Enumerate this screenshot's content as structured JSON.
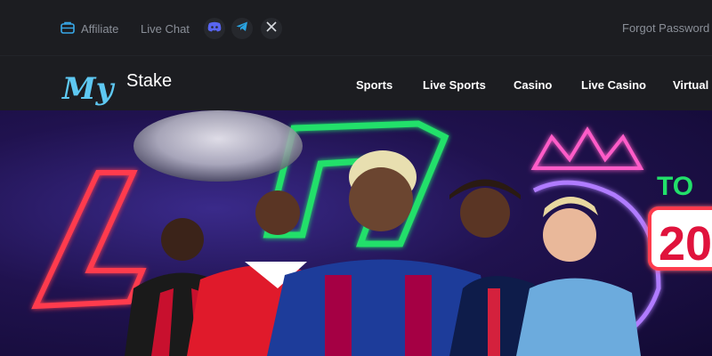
{
  "topbar": {
    "affiliate_label": "Affiliate",
    "live_chat_label": "Live Chat",
    "social": [
      "discord-icon",
      "telegram-icon",
      "x-icon"
    ],
    "forgot_password_label": "Forgot Password"
  },
  "brand": {
    "logo_script": "My",
    "logo_word": "Stake",
    "logo_color": "#5ec8f2"
  },
  "nav": {
    "items": [
      {
        "label": "Sports"
      },
      {
        "label": "Live Sports"
      },
      {
        "label": "Casino"
      },
      {
        "label": "Live Casino"
      },
      {
        "label": "Virtual"
      }
    ]
  },
  "hero": {
    "headline_partial": "TO",
    "year_partial": "20",
    "colors": {
      "accent_green": "#22e06a",
      "accent_red": "#ff3b4e",
      "accent_pink": "#ff5cc8",
      "accent_purple": "#b07cff"
    }
  },
  "colors": {
    "bar_bg": "#1c1d21",
    "muted_text": "#8a8f98",
    "nav_text": "#ffffff"
  }
}
